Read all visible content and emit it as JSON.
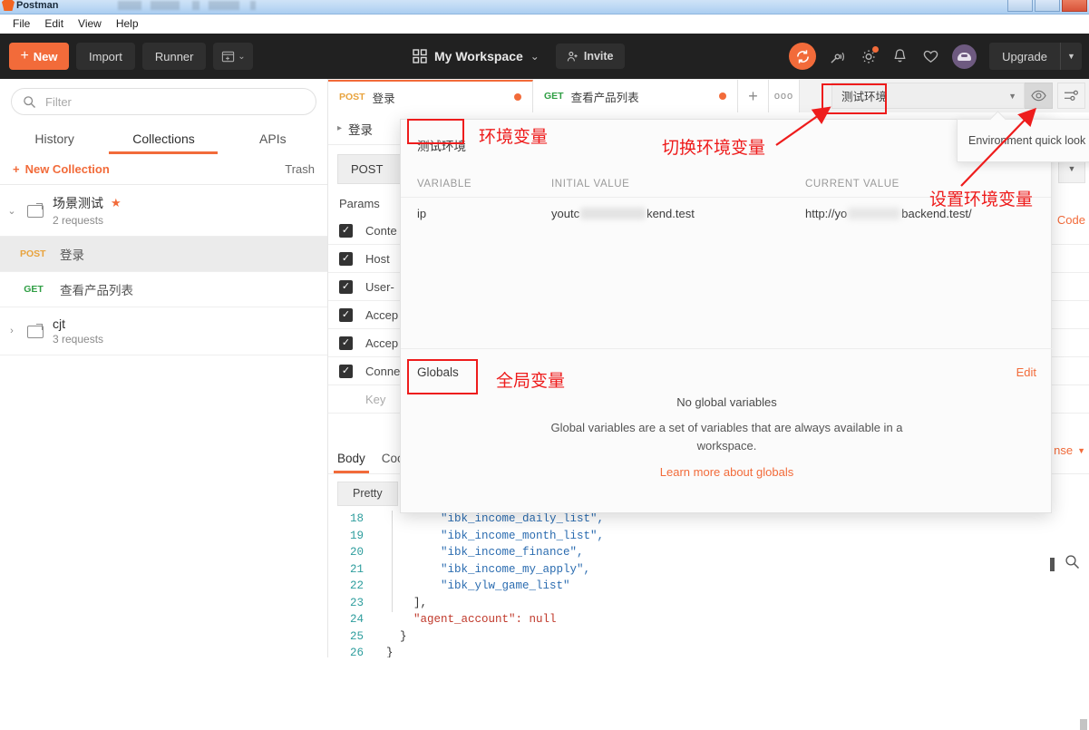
{
  "window": {
    "app_title": "Postman",
    "menu": [
      "File",
      "Edit",
      "View",
      "Help"
    ]
  },
  "header": {
    "new_button": "New",
    "new_plus": "+",
    "import_button": "Import",
    "runner_button": "Runner",
    "workspace_name": "My Workspace",
    "invite_button": "Invite",
    "upgrade_button": "Upgrade",
    "icons": {
      "grid": "grid-icon",
      "sync": "sync-icon",
      "satellite": "satellite-icon",
      "settings": "gear-icon",
      "notifications": "bell-icon",
      "favorites": "heart-icon",
      "account": "avatar-icon",
      "new_window": "new-window-icon"
    }
  },
  "sidebar": {
    "filter_placeholder": "Filter",
    "search_icon": "search-icon",
    "tabs": [
      {
        "label": "History",
        "active": false
      },
      {
        "label": "Collections",
        "active": true
      },
      {
        "label": "APIs",
        "active": false
      }
    ],
    "new_collection": "New Collection",
    "new_collection_plus": "+",
    "trash": "Trash",
    "collections": [
      {
        "name": "场景测试",
        "starred": true,
        "star_glyph": "★",
        "count": "2 requests",
        "expanded": true,
        "chevron": "⌄",
        "requests": [
          {
            "method": "POST",
            "name": "登录",
            "selected": true
          },
          {
            "method": "GET",
            "name": "查看产品列表",
            "selected": false
          }
        ]
      },
      {
        "name": "cjt",
        "starred": false,
        "count": "3 requests",
        "expanded": false,
        "chevron": "›",
        "requests": []
      }
    ]
  },
  "main": {
    "request_tabs": [
      {
        "method": "POST",
        "name": "登录",
        "active": true,
        "unsaved": true
      },
      {
        "method": "GET",
        "name": "查看产品列表",
        "active": false,
        "unsaved": true
      }
    ],
    "tab_add": "+",
    "tab_more": "ooo",
    "environment_selected": "测试环境",
    "environment_caret": "▼",
    "eye_icon": "eye-icon",
    "settings_icon": "sliders-icon",
    "request_title": "登录",
    "request_title_chevron": "▸",
    "method": "POST",
    "params_label": "Params",
    "code_link": "Code",
    "headers": [
      {
        "checked": true,
        "key": "Conte"
      },
      {
        "checked": true,
        "key": "Host"
      },
      {
        "checked": true,
        "key": "User-"
      },
      {
        "checked": true,
        "key": "Accep"
      },
      {
        "checked": true,
        "key": "Accep"
      },
      {
        "checked": true,
        "key": "Conne"
      },
      {
        "checked": false,
        "key": "Key"
      }
    ],
    "response_tabs": [
      {
        "label": "Body",
        "active": true
      },
      {
        "label": "Cook",
        "active": false
      }
    ],
    "pretty_button": "Pretty",
    "save_response": "nse",
    "save_response_caret": "▼",
    "code_lines": [
      {
        "num": "18",
        "text": "        \"ibk_income_daily_list\","
      },
      {
        "num": "19",
        "text": "        \"ibk_income_month_list\","
      },
      {
        "num": "20",
        "text": "        \"ibk_income_finance\","
      },
      {
        "num": "21",
        "text": "        \"ibk_income_my_apply\","
      },
      {
        "num": "22",
        "text": "        \"ibk_ylw_game_list\""
      },
      {
        "num": "23",
        "text": "    ],"
      },
      {
        "num": "24",
        "text": "    \"agent_account\": null"
      },
      {
        "num": "25",
        "text": "  }"
      },
      {
        "num": "26",
        "text": "}"
      }
    ]
  },
  "quicklook": {
    "environment_name": "测试环境",
    "columns": [
      "VARIABLE",
      "INITIAL VALUE",
      "CURRENT VALUE"
    ],
    "variables": [
      {
        "name": "ip",
        "initial_value_prefix": "youtc",
        "initial_value_suffix": "kend.test",
        "current_value_prefix": "http://yo",
        "current_value_suffix": "backend.test/"
      }
    ],
    "globals_label": "Globals",
    "edit_label": "Edit",
    "empty_title": "No global variables",
    "empty_body": "Global variables are a set of variables that are always available in a workspace.",
    "empty_link": "Learn more about globals"
  },
  "tooltip": {
    "text": "Environment quick look"
  },
  "annotations": [
    {
      "id": "env-var",
      "text": "环境变量"
    },
    {
      "id": "switch-env",
      "text": "切换环境变量"
    },
    {
      "id": "set-env",
      "text": "设置环境变量"
    },
    {
      "id": "global-var",
      "text": "全局变量"
    }
  ],
  "colors": {
    "accent": "#f26b3a",
    "annotation_red": "#ee1c1c",
    "post_method": "#e8a33d",
    "get_method": "#2f9e44",
    "dark_header": "#212121"
  }
}
